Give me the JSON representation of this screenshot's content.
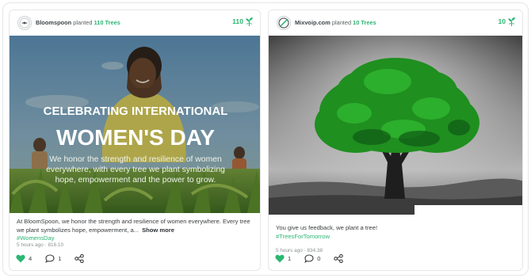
{
  "posts": [
    {
      "org": "Bloomspoon",
      "planted_text": "planted",
      "trees_text": "110 Trees",
      "tree_count": "110",
      "image": {
        "heading_line1": "CELEBRATING INTERNATIONAL",
        "heading_line2": "WOMEN'S DAY",
        "body_line1": "We honor the strength and resilience of women",
        "body_line2": "everywhere, with every tree we plant symbolizing",
        "body_line3": "hope, empowerment and the power to grow."
      },
      "caption": "At BloomSpoon, we honor the strength and resilience of women everywhere. Every tree we plant symbolizes hope, empowerment, a...",
      "show_more": "Show more",
      "hashtag": "#WomensDay",
      "time": "5 hours ago",
      "separator": "·",
      "post_id": "816.10",
      "likes": "4",
      "comments": "1",
      "colors": {
        "accent": "#2bb673"
      },
      "icons": [
        "heart-icon",
        "comment-icon",
        "share-icon",
        "sprout-icon"
      ]
    },
    {
      "org": "Mixvoip.com",
      "planted_text": "planted",
      "trees_text": "10 Trees",
      "tree_count": "10",
      "caption": "You give us feedback, we plant a tree!",
      "hashtag": "#TreesForTomorrow",
      "time": "5 hours ago",
      "separator": "·",
      "post_id": "834.38",
      "likes": "1",
      "comments": "0",
      "colors": {
        "accent": "#2bb673"
      },
      "icons": [
        "heart-icon",
        "comment-icon",
        "share-icon",
        "sprout-icon"
      ]
    }
  ]
}
